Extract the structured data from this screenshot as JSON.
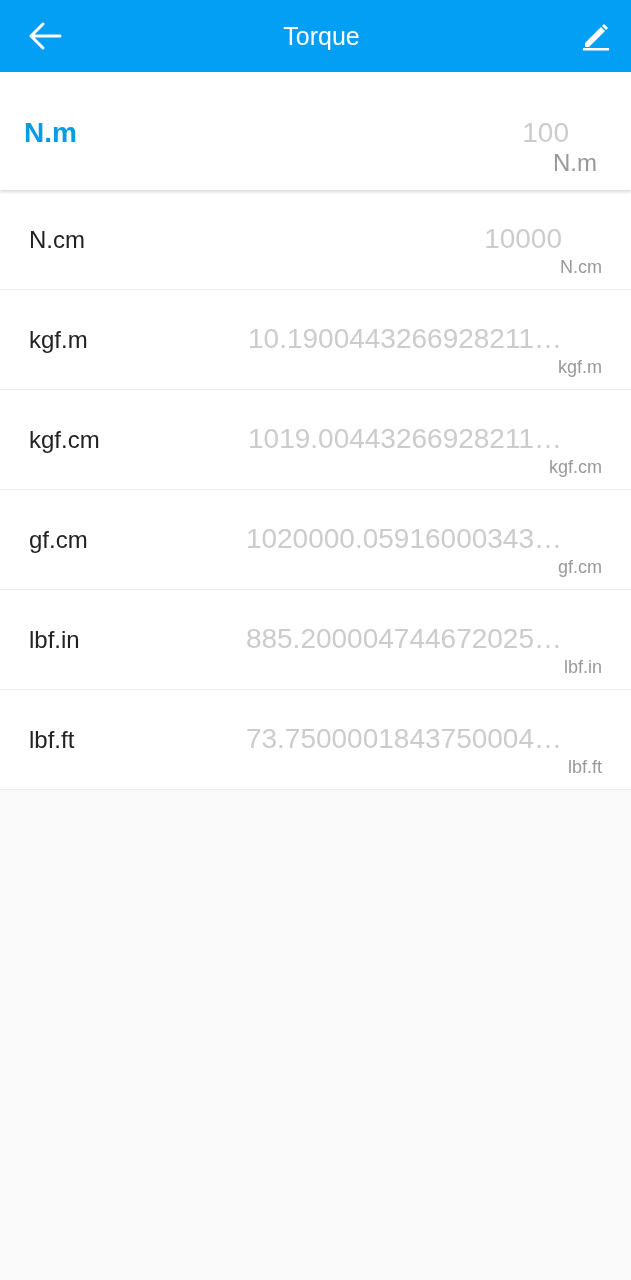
{
  "app_bar": {
    "title": "Torque"
  },
  "units": [
    {
      "name": "N.m",
      "value": "100",
      "unit": "N.m",
      "selected": true
    },
    {
      "name": "N.cm",
      "value": "10000",
      "unit": "N.cm",
      "selected": false
    },
    {
      "name": "kgf.m",
      "value": "10.1900443266928211…",
      "unit": "kgf.m",
      "selected": false
    },
    {
      "name": "kgf.cm",
      "value": "1019.00443266928211…",
      "unit": "kgf.cm",
      "selected": false
    },
    {
      "name": "gf.cm",
      "value": "1020000.05916000343…",
      "unit": "gf.cm",
      "selected": false
    },
    {
      "name": "lbf.in",
      "value": "885.200004744672025…",
      "unit": "lbf.in",
      "selected": false
    },
    {
      "name": "lbf.ft",
      "value": "73.7500001843750004…",
      "unit": "lbf.ft",
      "selected": false
    }
  ]
}
